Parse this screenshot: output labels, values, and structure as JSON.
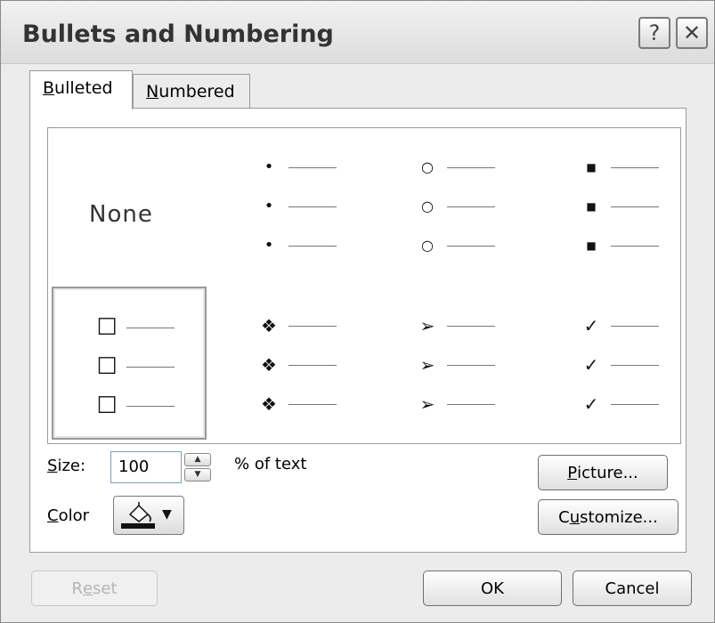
{
  "window": {
    "title": "Bullets and Numbering",
    "help_label": "?",
    "close_label": "✕"
  },
  "tabs": [
    {
      "label": "Bulleted",
      "accel": "B",
      "rest": "ulleted",
      "selected": true
    },
    {
      "label": "Numbered",
      "accel": "N",
      "rest": "umbered",
      "selected": false
    }
  ],
  "gallery": {
    "none_label": "None",
    "styles": [
      {
        "name": "none",
        "glyph": ""
      },
      {
        "name": "small-dot",
        "glyph": "•"
      },
      {
        "name": "hollow-circle",
        "glyph": "○"
      },
      {
        "name": "filled-square",
        "glyph": "■"
      },
      {
        "name": "hollow-square",
        "glyph": "☐",
        "selected": true
      },
      {
        "name": "four-diamond",
        "glyph": "❖"
      },
      {
        "name": "arrowhead",
        "glyph": "➢"
      },
      {
        "name": "checkmark",
        "glyph": "✓"
      }
    ]
  },
  "size": {
    "label_accel": "S",
    "label_rest": "ize:",
    "value": "100",
    "suffix": "% of text"
  },
  "color": {
    "label_accel": "C",
    "label_rest": "olor",
    "swatch": "#111111"
  },
  "buttons": {
    "picture": {
      "accel": "P",
      "rest": "icture..."
    },
    "customize": {
      "pre": "C",
      "accel": "u",
      "rest": "stomize..."
    },
    "reset": {
      "pre": "R",
      "accel": "e",
      "rest": "set"
    },
    "ok": "OK",
    "cancel": "Cancel"
  }
}
